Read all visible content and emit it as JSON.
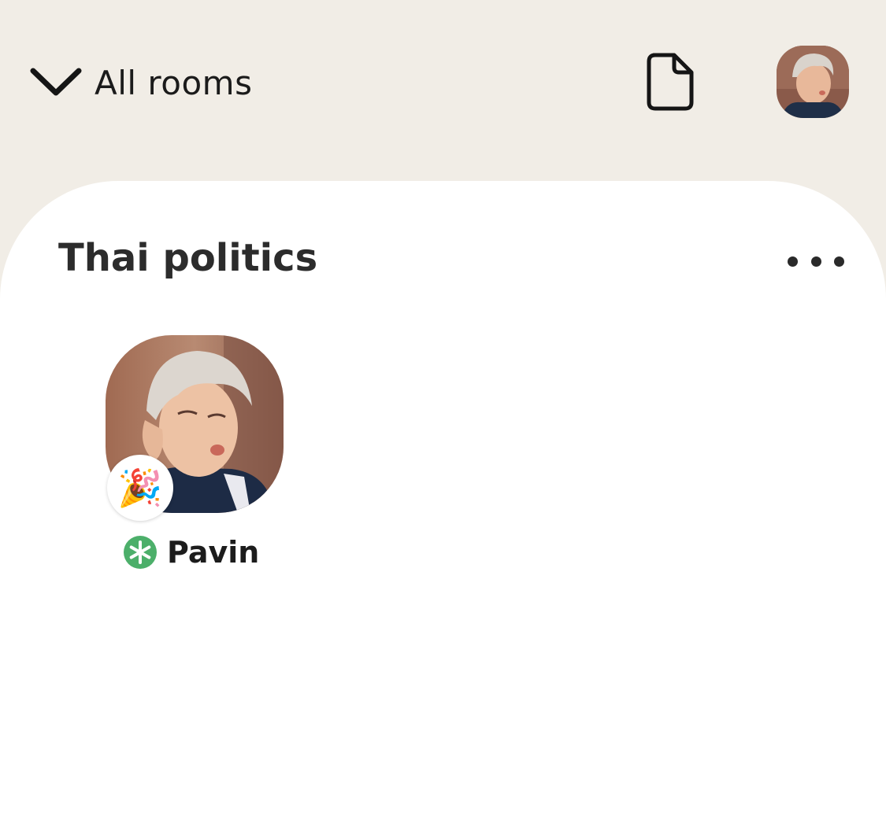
{
  "header": {
    "back_label": "All rooms",
    "back_icon": "chevron-down-icon",
    "doc_icon": "document-icon",
    "profile_icon": "profile-avatar"
  },
  "room": {
    "title": "Thai politics",
    "more_icon": "more-horizontal-icon",
    "speakers": [
      {
        "name": "Pavin",
        "badge_emoji": "🎉",
        "role_icon": "moderator-asterisk-icon",
        "role_color": "#4caf6a"
      }
    ]
  },
  "colors": {
    "background": "#f1ede6",
    "card": "#ffffff",
    "text": "#2c2c2c",
    "moderator": "#4caf6a"
  }
}
